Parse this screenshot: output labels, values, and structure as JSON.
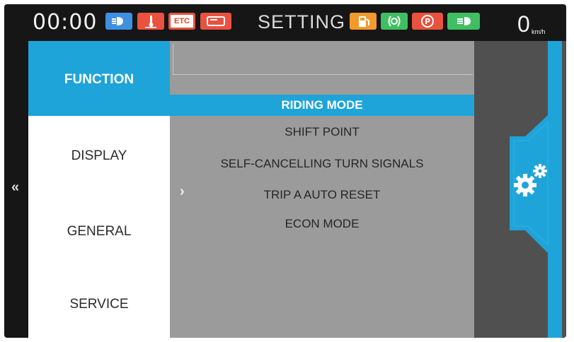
{
  "topbar": {
    "clock": "00:00",
    "title": "SETTING",
    "speed": "0",
    "speed_unit": "km/h",
    "indicators": {
      "headlight": "",
      "temperature": "",
      "etc": "ETC",
      "etc2": ""
    }
  },
  "nav": {
    "back": "«",
    "forward": "›"
  },
  "sidebar": {
    "items": [
      {
        "label": "FUNCTION",
        "active": true
      },
      {
        "label": "DISPLAY",
        "active": false
      },
      {
        "label": "GENERAL",
        "active": false
      },
      {
        "label": "SERVICE",
        "active": false
      }
    ]
  },
  "main": {
    "items": [
      {
        "label": "RIDING MODE",
        "selected": true
      },
      {
        "label": "SHIFT POINT",
        "selected": false
      },
      {
        "label": "SELF-CANCELLING TURN SIGNALS",
        "selected": false
      },
      {
        "label": "TRIP A AUTO RESET",
        "selected": false
      },
      {
        "label": "ECON MODE",
        "selected": false
      }
    ]
  },
  "right_panel": {
    "icon": "gears-icon"
  },
  "colors": {
    "accent": "#1ea4d8",
    "screen_bg": "#161616",
    "list_bg": "#9b9b9b",
    "warning": "#e8523f",
    "green": "#3fbf62",
    "orange": "#f29a2e",
    "blue": "#3f8fe0"
  }
}
